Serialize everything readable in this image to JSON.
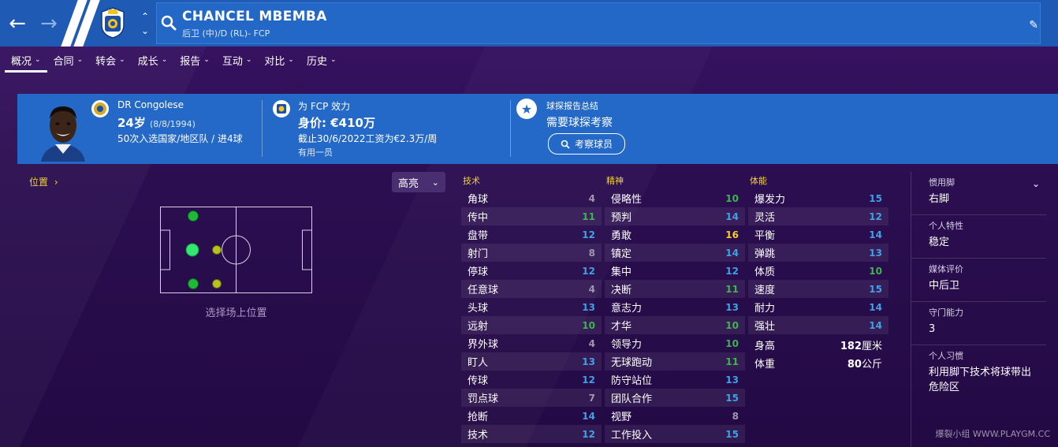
{
  "header": {
    "player_name": "CHANCEL MBEMBA",
    "player_subtitle": "后卫 (中)/D (RL)- FCP"
  },
  "tabs": [
    {
      "label": "概况"
    },
    {
      "label": "合同"
    },
    {
      "label": "转会"
    },
    {
      "label": "成长"
    },
    {
      "label": "报告"
    },
    {
      "label": "互动"
    },
    {
      "label": "对比"
    },
    {
      "label": "历史"
    }
  ],
  "banner": {
    "nationality": "DR Congolese",
    "age": "24岁",
    "dob": "(8/8/1994)",
    "caps": "50次入选国家/地区队 / 进4球",
    "club_line": "为 FCP 效力",
    "value": "身价: €410万",
    "contract": "截止30/6/2022工资为€2.3万/周",
    "role": "有用一员",
    "scout_title": "球探报告总结",
    "scout_text": "需要球探考察",
    "scout_button": "考察球员"
  },
  "position": {
    "label": "位置",
    "highlight": "高亮",
    "caption": "选择场上位置"
  },
  "attributes": {
    "technical": {
      "title": "技术",
      "items": [
        {
          "name": "角球",
          "value": "4",
          "color": "gray"
        },
        {
          "name": "传中",
          "value": "11",
          "color": "green"
        },
        {
          "name": "盘带",
          "value": "12",
          "color": "blue"
        },
        {
          "name": "射门",
          "value": "8",
          "color": "gray"
        },
        {
          "name": "停球",
          "value": "12",
          "color": "blue"
        },
        {
          "name": "任意球",
          "value": "4",
          "color": "gray"
        },
        {
          "name": "头球",
          "value": "13",
          "color": "blue"
        },
        {
          "name": "远射",
          "value": "10",
          "color": "green"
        },
        {
          "name": "界外球",
          "value": "4",
          "color": "gray"
        },
        {
          "name": "盯人",
          "value": "13",
          "color": "blue"
        },
        {
          "name": "传球",
          "value": "12",
          "color": "blue"
        },
        {
          "name": "罚点球",
          "value": "7",
          "color": "gray"
        },
        {
          "name": "抢断",
          "value": "14",
          "color": "blue"
        },
        {
          "name": "技术",
          "value": "12",
          "color": "blue"
        }
      ]
    },
    "mental": {
      "title": "精神",
      "items": [
        {
          "name": "侵略性",
          "value": "10",
          "color": "green"
        },
        {
          "name": "预判",
          "value": "14",
          "color": "blue"
        },
        {
          "name": "勇敢",
          "value": "16",
          "color": "yellow"
        },
        {
          "name": "镇定",
          "value": "14",
          "color": "blue"
        },
        {
          "name": "集中",
          "value": "12",
          "color": "blue"
        },
        {
          "name": "决断",
          "value": "11",
          "color": "green"
        },
        {
          "name": "意志力",
          "value": "13",
          "color": "blue"
        },
        {
          "name": "才华",
          "value": "10",
          "color": "green"
        },
        {
          "name": "领导力",
          "value": "10",
          "color": "green"
        },
        {
          "name": "无球跑动",
          "value": "11",
          "color": "green"
        },
        {
          "name": "防守站位",
          "value": "13",
          "color": "blue"
        },
        {
          "name": "团队合作",
          "value": "15",
          "color": "blue"
        },
        {
          "name": "视野",
          "value": "8",
          "color": "gray"
        },
        {
          "name": "工作投入",
          "value": "15",
          "color": "blue"
        }
      ]
    },
    "physical": {
      "title": "体能",
      "items": [
        {
          "name": "爆发力",
          "value": "15",
          "color": "blue"
        },
        {
          "name": "灵活",
          "value": "12",
          "color": "blue"
        },
        {
          "name": "平衡",
          "value": "14",
          "color": "blue"
        },
        {
          "name": "弹跳",
          "value": "13",
          "color": "blue"
        },
        {
          "name": "体质",
          "value": "10",
          "color": "green"
        },
        {
          "name": "速度",
          "value": "15",
          "color": "blue"
        },
        {
          "name": "耐力",
          "value": "14",
          "color": "blue"
        },
        {
          "name": "强壮",
          "value": "14",
          "color": "blue"
        }
      ],
      "extras": [
        {
          "name": "身高",
          "value": "182",
          "unit": "厘米"
        },
        {
          "name": "体重",
          "value": "80",
          "unit": "公斤"
        }
      ]
    }
  },
  "sidebar": {
    "preferred_foot_label": "惯用脚",
    "preferred_foot": "右脚",
    "personality_label": "个人特性",
    "personality": "稳定",
    "media_label": "媒体评价",
    "media": "中后卫",
    "gk_label": "守门能力",
    "gk": "3",
    "habits_label": "个人习惯",
    "habits": "利用脚下技术将球带出危险区"
  },
  "colors": {
    "gray": "#9f98ad",
    "green": "#3fb34f",
    "blue": "#3ea1e6",
    "yellow": "#f5d020",
    "accent": "#2469c8"
  },
  "watermark": "爆裂小组 WWW.PLAYGM.CC"
}
